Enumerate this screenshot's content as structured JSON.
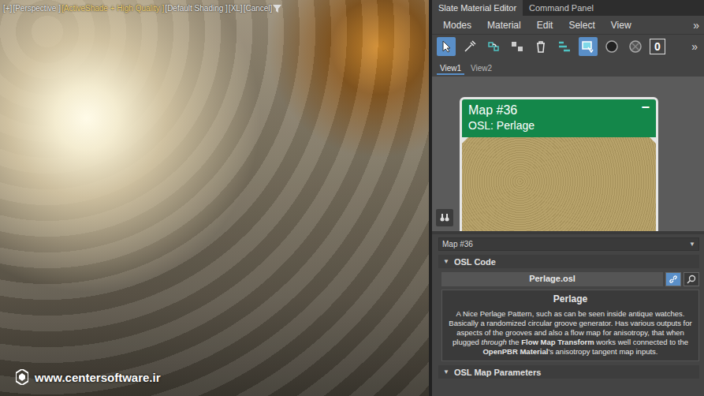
{
  "viewport": {
    "labels": [
      {
        "text": "[+]",
        "highlighted": false
      },
      {
        "text": "[Perspective ]",
        "highlighted": false
      },
      {
        "text": "[ActiveShade + High Quality ]",
        "highlighted": true
      },
      {
        "text": "[Default Shading ]",
        "highlighted": false
      },
      {
        "text": "[XL]",
        "highlighted": false
      },
      {
        "text": "[Cancel]",
        "highlighted": false
      }
    ],
    "watermark": "www.centersoftware.ir"
  },
  "panel_tabs": [
    {
      "label": "Slate Material Editor",
      "selected": true
    },
    {
      "label": "Command Panel",
      "selected": false
    }
  ],
  "menu": {
    "items": [
      "Modes",
      "Material",
      "Edit",
      "Select",
      "View"
    ],
    "overflow": "»"
  },
  "toolbar": {
    "tools": [
      {
        "kind": "select",
        "selected": true
      },
      {
        "kind": "eyedropper",
        "selected": false
      },
      {
        "kind": "put",
        "selected": false
      },
      {
        "kind": "assign",
        "selected": false
      },
      {
        "kind": "delete",
        "selected": false
      },
      {
        "kind": "layout",
        "selected": false
      },
      {
        "kind": "showmap",
        "selected": true
      },
      {
        "kind": "background",
        "selected": false
      },
      {
        "kind": "checker",
        "selected": false
      }
    ],
    "badge": "0",
    "overflow": "»"
  },
  "view_tabs": [
    {
      "label": "View1",
      "selected": true
    },
    {
      "label": "View2",
      "selected": false
    }
  ],
  "node": {
    "title": "Map #36",
    "subtitle": "OSL: Perlage",
    "collapse": "−"
  },
  "params": {
    "header": "Map #36",
    "header_arrow": "▼",
    "rollouts": [
      {
        "title": "OSL Code",
        "arrow": "▼",
        "expanded": true,
        "file": "Perlage.osl",
        "description_title": "Perlage",
        "description": [
          {
            "text": "A Nice Perlage Pattern, such as can be seen inside antique watches. Basically a randomized circular groove generator. Has various outputs for aspects of the grooves and also a flow map for anisotropy, that when plugged ",
            "style": "normal"
          },
          {
            "text": "through",
            "style": "italic"
          },
          {
            "text": " the ",
            "style": "normal"
          },
          {
            "text": "Flow Map Transform",
            "style": "bold"
          },
          {
            "text": " works well connected to the ",
            "style": "normal"
          },
          {
            "text": "OpenPBR Material",
            "style": "bold"
          },
          {
            "text": "'s anisotropy tangent map inputs.",
            "style": "normal"
          }
        ]
      },
      {
        "title": "OSL Map Parameters",
        "arrow": "▼",
        "expanded": false
      }
    ]
  }
}
